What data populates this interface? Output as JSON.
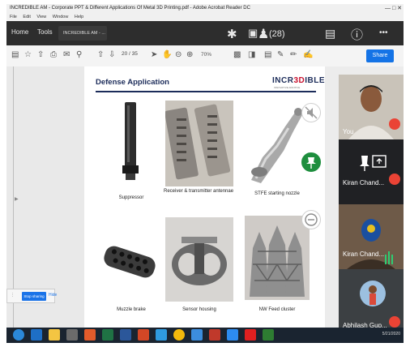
{
  "window": {
    "title": "INCREDIBLE AM - Corporate PPT & Different Applications Of Metal 3D Printing.pdf - Adobe Acrobat Reader DC",
    "menu": [
      "File",
      "Edit",
      "View",
      "Window",
      "Help"
    ]
  },
  "acrobat": {
    "tabs": {
      "home": "Home",
      "tools": "Tools",
      "doc": "INCREDIBLE AM - ..."
    },
    "page_indicator": "20 / 35",
    "zoom": "70%",
    "share_label": "Share"
  },
  "meet": {
    "participant_count": "(28)",
    "stop_sharing_label": "Stop sharing",
    "hide_label": "Hide",
    "participants": [
      {
        "name": "You",
        "muted": true
      },
      {
        "name": "Kiran Chand...",
        "muted": true
      },
      {
        "name": "Kiran Chand...",
        "muted": false
      },
      {
        "name": "Abhilash Gup...",
        "muted": true
      }
    ]
  },
  "slide": {
    "title": "Defense Application",
    "logo": {
      "pre": "INCR",
      "mid": "3D",
      "post": "IBLE"
    },
    "logo_sub": "INNOVATIVE ADDITIVE",
    "products": [
      {
        "label": "Suppressor"
      },
      {
        "label": "Receiver & transmitter antennae"
      },
      {
        "label": "STFE starting nozzle"
      },
      {
        "label": "Muzzle brake"
      },
      {
        "label": "Sensor housing"
      },
      {
        "label": "NW Feed cluster"
      }
    ]
  },
  "taskbar": {
    "clock": "5/21/2020"
  },
  "colors": {
    "accent": "#1473e6",
    "slide_title": "#1c2c5a",
    "logo_red": "#c8102e",
    "mute_red": "#ea4335",
    "pin_green": "#1e8e3e"
  }
}
